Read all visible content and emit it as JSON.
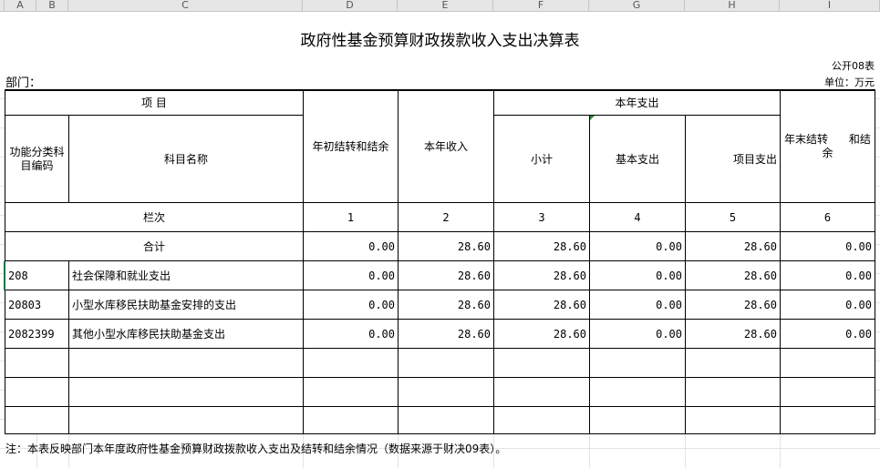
{
  "column_letters": [
    "A",
    "B",
    "C",
    "D",
    "E",
    "F",
    "G",
    "H",
    "I"
  ],
  "title": "政府性基金预算财政拨款收入支出决算表",
  "table_no": "公开08表",
  "unit": "单位：万元",
  "dept": "部门：",
  "header": {
    "project": "项    目",
    "code": "功能分类科目编码",
    "name": "科目名称",
    "beginning": "年初结转和结余",
    "income": "本年收入",
    "expense_group": "本年支出",
    "subtotal": "小计",
    "basic": "基本支出",
    "project_exp": "项目支出",
    "ending": "年末结转      和结余"
  },
  "column_index": {
    "label": "栏次",
    "nums": [
      "1",
      "2",
      "3",
      "4",
      "5",
      "6"
    ]
  },
  "rows": [
    {
      "code": "",
      "name": "合计",
      "values": [
        "0.00",
        "28.60",
        "28.60",
        "0.00",
        "28.60",
        "0.00"
      ]
    },
    {
      "code": "208",
      "name": "社会保障和就业支出",
      "values": [
        "0.00",
        "28.60",
        "28.60",
        "0.00",
        "28.60",
        "0.00"
      ]
    },
    {
      "code": "20803",
      "name": "小型水库移民扶助基金安排的支出",
      "values": [
        "0.00",
        "28.60",
        "28.60",
        "0.00",
        "28.60",
        "0.00"
      ]
    },
    {
      "code": "2082399",
      "name": "其他小型水库移民扶助基金支出",
      "values": [
        "0.00",
        "28.60",
        "28.60",
        "0.00",
        "28.60",
        "0.00"
      ]
    }
  ],
  "footnote": "注：本表反映部门本年度政府性基金预算财政拨款收入支出及结转和结余情况（数据来源于财决09表）。"
}
